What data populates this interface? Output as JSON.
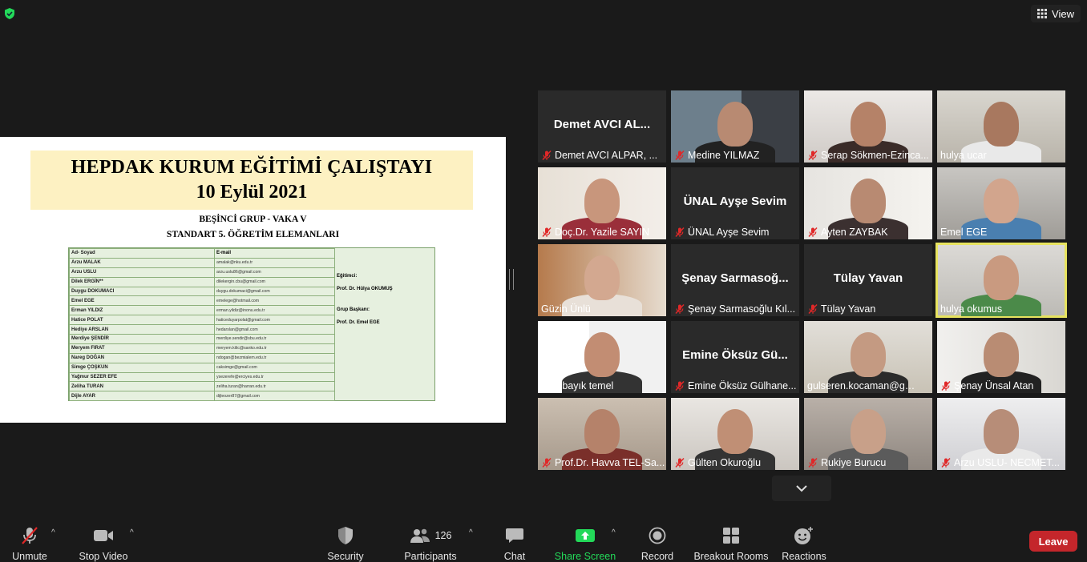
{
  "top": {
    "view_label": "View"
  },
  "slide": {
    "title_line1": "HEPDAK KURUM EĞİTİMİ ÇALIŞTAYI",
    "title_line2": "10 Eylül 2021",
    "subtitle1": "BEŞİNCİ GRUP - VAKA V",
    "subtitle2": "STANDART 5. ÖĞRETİM ELEMANLARI",
    "col_name": "Ad- Soyad",
    "col_email": "E-mail",
    "rows": [
      {
        "name": "Arzu MALAK",
        "email": "amalak@nku.edu.tr"
      },
      {
        "name": "Arzu USLU",
        "email": "arzu.uslu86@gmail.com"
      },
      {
        "name": "Dilek ERGİN**",
        "email": "dilekergin.cbu@gmail.com"
      },
      {
        "name": "Duygu DOKUMACI",
        "email": "duygu.dokumaci@gmail.com"
      },
      {
        "name": "Emel EGE",
        "email": "emelege@hotmail.com"
      },
      {
        "name": "Erman YILDIZ",
        "email": "erman.yildiz@inonu.edu.tr"
      },
      {
        "name": "Hatice POLAT",
        "email": "haticeduyarpolat@gmail.com"
      },
      {
        "name": "Hediye ARSLAN",
        "email": "hedarslan@gmail.com"
      },
      {
        "name": "Merdiye ŞENDİR",
        "email": "merdiye.sendir@sbu.edu.tr"
      },
      {
        "name": "Meryem FIRAT",
        "email": "meryem.kilic@sanko.edu.tr"
      },
      {
        "name": "Nareg DOĞAN",
        "email": "ndogan@bezmialem.edu.tr"
      },
      {
        "name": "Simge ÇOŞKUN",
        "email": "caksimge@gmail.com"
      },
      {
        "name": "Yağmur SEZER EFE",
        "email": "ysezerefe@erciyes.edu.tr"
      },
      {
        "name": "Zeliha TURAN",
        "email": "zeliha.turan@harran.edu.tr"
      },
      {
        "name": "Dijle AYAR",
        "email": "dijleozer87@gmail.com"
      }
    ],
    "trainer_label": "Eğitimci:",
    "trainer_name": "Prof. Dr. Hülya OKUMUŞ",
    "lead_label": "Grup Başkanı:",
    "lead_name": "Prof. Dr. Emel EGE"
  },
  "participants": [
    {
      "caption": "Demet AVCI ALPAR, ...",
      "big": "Demet AVCI AL...",
      "muted": true
    },
    {
      "caption": "Medine YILMAZ",
      "muted": true
    },
    {
      "caption": "Serap Sökmen-Ezinca...",
      "muted": true
    },
    {
      "caption": "hulya ucar",
      "muted": false
    },
    {
      "caption": "Doç.Dr. Yazile SAYIN",
      "muted": true
    },
    {
      "caption": "ÜNAL Ayşe Sevim",
      "big": "ÜNAL Ayşe Sevim",
      "muted": true
    },
    {
      "caption": "Ayten ZAYBAK",
      "muted": true
    },
    {
      "caption": "Emel EGE",
      "muted": false
    },
    {
      "caption": "Güzin Ünlü",
      "muted": false
    },
    {
      "caption": "Şenay Sarmasoğlu Kıl...",
      "big": "Şenay  Sarmasoğ...",
      "muted": true
    },
    {
      "caption": "Tülay Yavan",
      "big": "Tülay Yavan",
      "muted": true
    },
    {
      "caption": "hulya okumus",
      "muted": false,
      "active": true
    },
    {
      "caption": "ayla bayık temel",
      "muted": false
    },
    {
      "caption": "Emine Öksüz Gülhane...",
      "big": "Emine Öksüz Gü...",
      "muted": true
    },
    {
      "caption": "gulseren.kocaman@gma...",
      "muted": false
    },
    {
      "caption": "Şenay Ünsal Atan",
      "muted": true
    },
    {
      "caption": "Prof.Dr. Havva TEL-Sa...",
      "muted": true
    },
    {
      "caption": "Gülten Okuroğlu",
      "muted": true
    },
    {
      "caption": "Rukiye Burucu",
      "muted": true
    },
    {
      "caption": "Arzu USLU- NECMET...",
      "muted": true
    }
  ],
  "toolbar": {
    "unmute": "Unmute",
    "stop_video": "Stop Video",
    "security": "Security",
    "participants": "Participants",
    "participant_count": "126",
    "chat": "Chat",
    "share_screen": "Share Screen",
    "record": "Record",
    "breakout": "Breakout Rooms",
    "reactions": "Reactions",
    "leave": "Leave"
  },
  "colors": {
    "leave": "#c4262b",
    "share": "#23d959",
    "active_speaker": "#e7e35f",
    "muted_red": "#e02828"
  }
}
